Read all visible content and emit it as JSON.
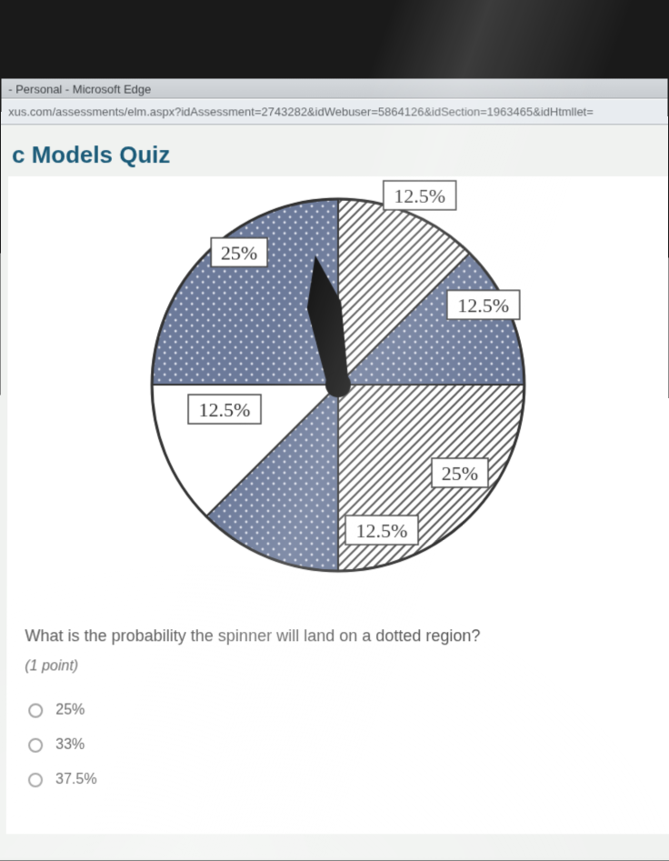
{
  "window": {
    "title_suffix": " - Personal - Microsoft Edge",
    "url_fragment": "xus.com/assessments/elm.aspx?idAssessment=2743282&idWebuser=5864126&idSection=1963465&idHtmllet="
  },
  "quiz": {
    "title_visible": "c Models Quiz",
    "question": "What is the probability the spinner will land on a dotted region?",
    "points_label": "(1 point)",
    "options": [
      "25%",
      "33%",
      "37.5%"
    ]
  },
  "chart_data": {
    "type": "pie",
    "title": "",
    "slices": [
      {
        "label": "12.5%",
        "value": 12.5,
        "pattern": "hatched",
        "start_deg": 0,
        "end_deg": 45
      },
      {
        "label": "12.5%",
        "value": 12.5,
        "pattern": "dotted",
        "start_deg": 45,
        "end_deg": 90
      },
      {
        "label": "25%",
        "value": 25,
        "pattern": "hatched",
        "start_deg": 90,
        "end_deg": 180
      },
      {
        "label": "12.5%",
        "value": 12.5,
        "pattern": "dotted",
        "start_deg": 180,
        "end_deg": 225
      },
      {
        "label": "12.5%",
        "value": 12.5,
        "pattern": "blank",
        "start_deg": 225,
        "end_deg": 270
      },
      {
        "label": "25%",
        "value": 25,
        "pattern": "dotted",
        "start_deg": 270,
        "end_deg": 360
      }
    ],
    "spinner_angle_deg": 350
  }
}
